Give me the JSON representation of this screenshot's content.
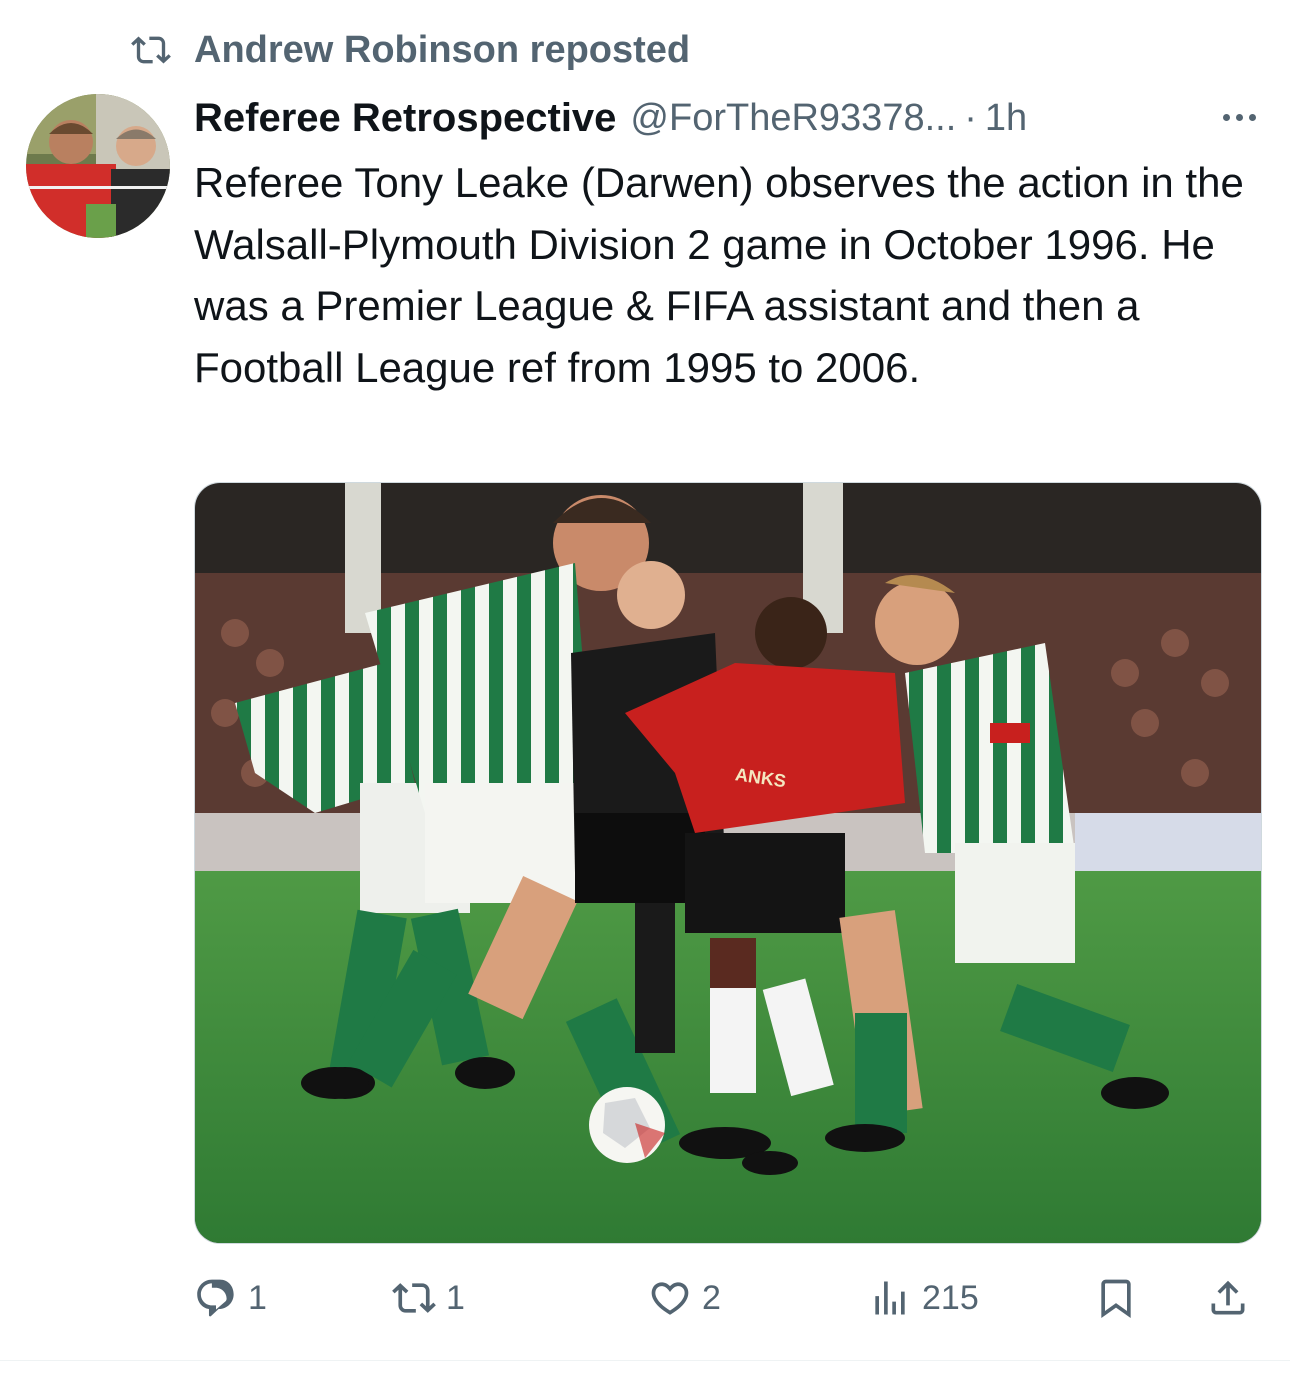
{
  "repost": {
    "text": "Andrew Robinson reposted",
    "icon": "repost-icon"
  },
  "tweet": {
    "display_name": "Referee Retrospective",
    "handle": "@ForTheR93378...",
    "separator": "·",
    "time": "1h",
    "text": "Referee Tony Leake (Darwen) observes the action in the Walsall-Plymouth Division 2 game in October 1996. He was a Premier League & FIFA assistant and then a Football League ref from 1995 to 2006.",
    "media": {
      "shirt_sponsor": "ANKS"
    }
  },
  "actions": {
    "replies": "1",
    "reposts": "1",
    "likes": "2",
    "views": "215"
  },
  "colors": {
    "text_primary": "#0f1419",
    "text_secondary": "#536471",
    "pitch_green": "#3c8a3a",
    "walsall_red": "#c8201e",
    "plymouth_green": "#1f7a45"
  }
}
